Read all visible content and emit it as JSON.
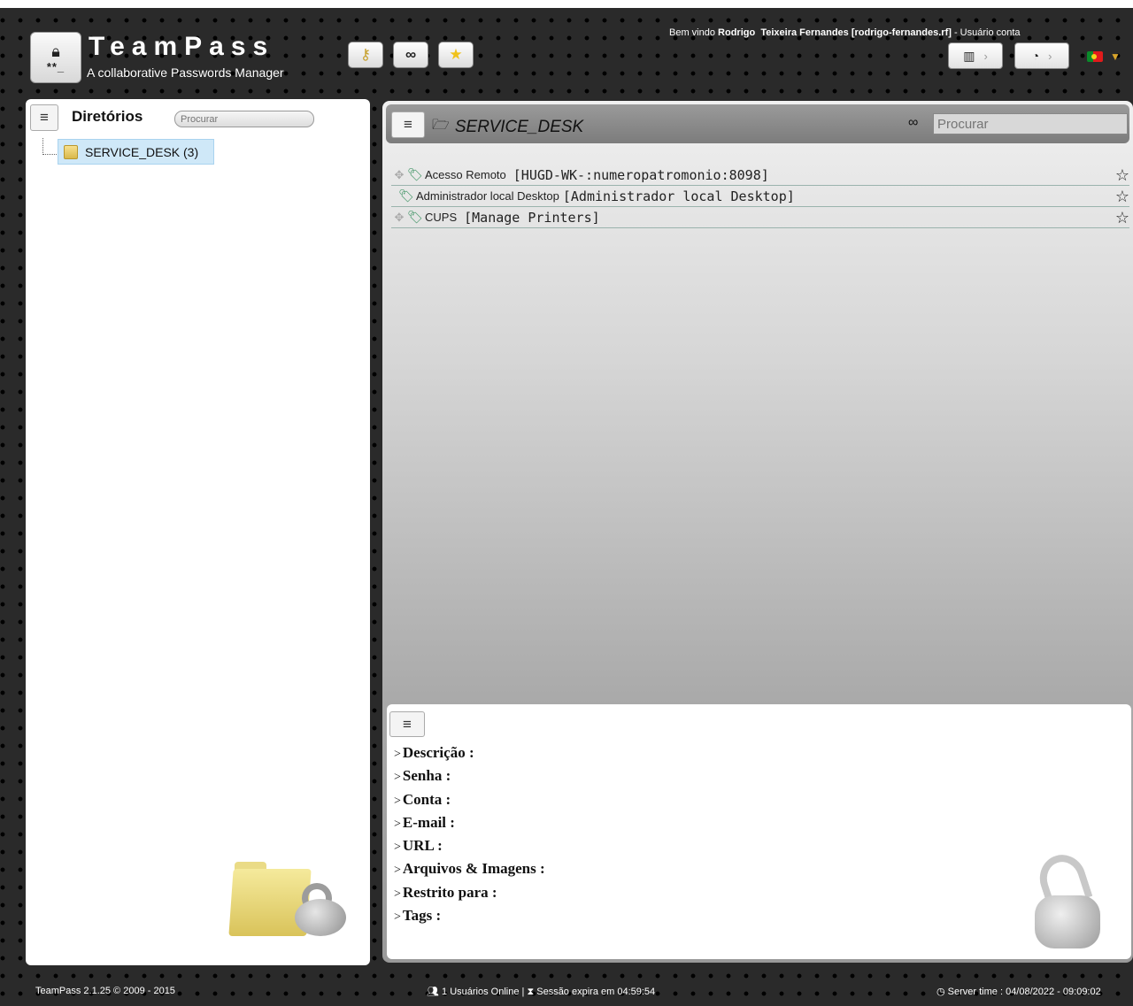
{
  "header": {
    "brand_title": "TeamPass",
    "brand_subtitle": "A collaborative Passwords Manager",
    "welcome_prefix": "Bem vindo ",
    "user_first": "Rodrigo",
    "user_rest": "Teixeira Fernandes [rodrigo-fernandes.rf]",
    "welcome_suffix": " - Usuário conta",
    "toolbar_icons": [
      "key-icon",
      "binoculars-icon",
      "star-icon"
    ],
    "nav_icons": [
      "map-icon",
      "dashboard-icon"
    ],
    "language_flag": "portugal-flag"
  },
  "sidebar": {
    "title": "Diretórios",
    "search_placeholder": "Procurar",
    "tree": [
      {
        "label": "SERVICE_DESK (3)"
      }
    ]
  },
  "main": {
    "folder_title": "SERVICE_DESK",
    "search_placeholder": "Procurar",
    "items": [
      {
        "label": "Acesso Remoto",
        "account": "[HUGD-WK-:numeropatromonio:8098]",
        "movable": true
      },
      {
        "label": "Administrador local Desktop",
        "account": "[Administrador local Desktop]",
        "movable": false
      },
      {
        "label": "CUPS",
        "account": "[Manage Printers]",
        "movable": true
      }
    ]
  },
  "details": {
    "fields": [
      "Descrição :",
      "Senha :",
      "Conta :",
      "E-mail :",
      "URL :",
      "Arquivos & Imagens :",
      "Restrito para :",
      "Tags :"
    ]
  },
  "footer": {
    "version": "TeamPass 2.1.25 © 2009 - 2015",
    "online": "1 Usuários Online | ",
    "session": "Sessão expira em  04:59:54",
    "server_time": "Server time : 04/08/2022 - 09:09:02"
  },
  "colors": {
    "tree_selected_bg": "#cfe8f8",
    "tag_green": "#2e8b57",
    "flag_gold": "#d8a42a"
  }
}
